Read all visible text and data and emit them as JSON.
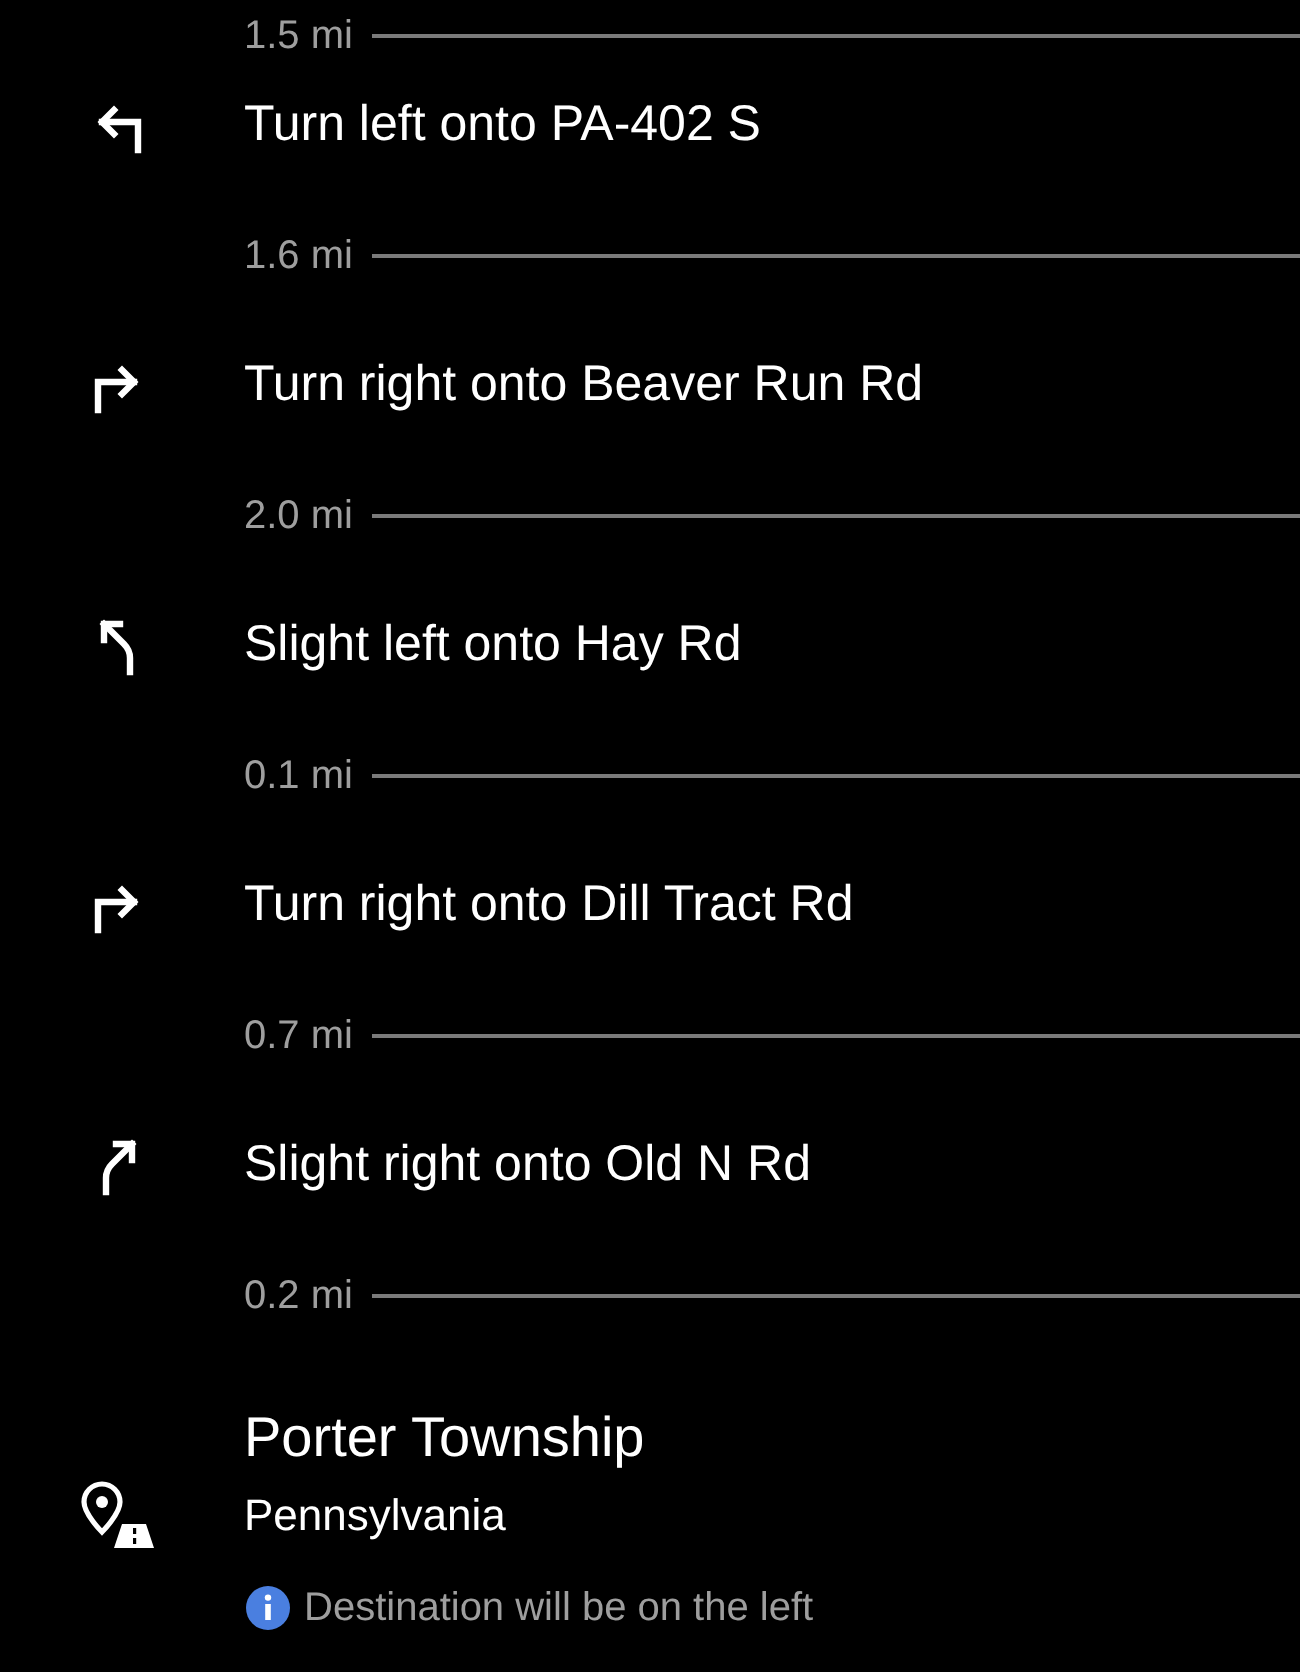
{
  "previous_distance": "1.5 mi",
  "steps": [
    {
      "kind": "turn-left",
      "instruction": "Turn left onto PA-402 S",
      "distance": "1.6 mi"
    },
    {
      "kind": "turn-right",
      "instruction": "Turn right onto Beaver Run Rd",
      "distance": "2.0 mi"
    },
    {
      "kind": "slight-left",
      "instruction": "Slight left onto Hay Rd",
      "distance": "0.1 mi"
    },
    {
      "kind": "turn-right",
      "instruction": "Turn right onto Dill Tract Rd",
      "distance": "0.7 mi"
    },
    {
      "kind": "slight-right",
      "instruction": "Slight right onto Old N Rd",
      "distance": "0.2 mi"
    }
  ],
  "destination": {
    "name": "Porter Township",
    "region": "Pennsylvania",
    "note": "Destination will be on the left"
  }
}
